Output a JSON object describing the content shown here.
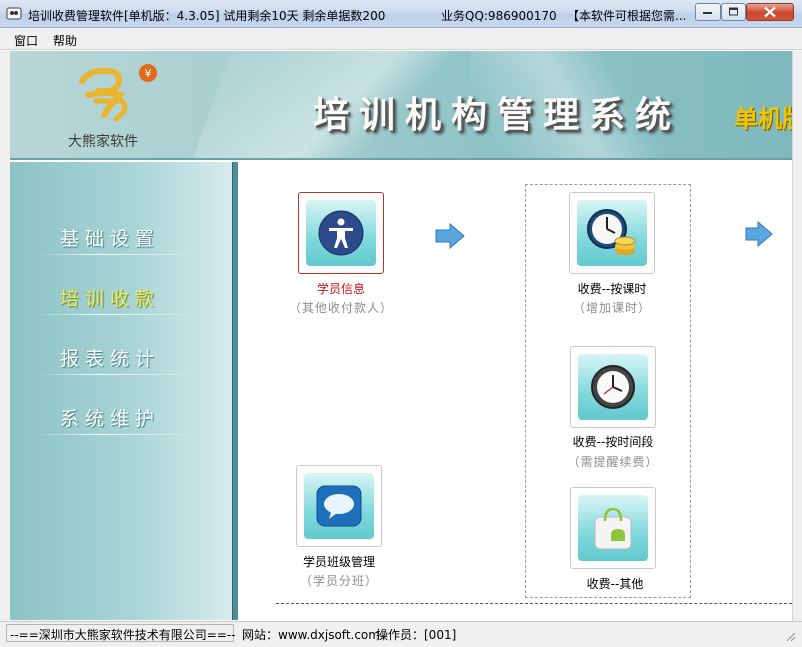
{
  "window": {
    "title": "培训收费管理软件[单机版：4.3.05]  试用剩余10天  剩余单据数200",
    "qq": "业务QQ:986900170",
    "note": "【本软件可根据您需..."
  },
  "menu": {
    "items": [
      "窗口",
      "帮助"
    ]
  },
  "banner": {
    "logo_text": "大熊家软件",
    "title": "培训机构管理系统",
    "edition": "单机版"
  },
  "sidebar": {
    "items": [
      {
        "label": "基础设置",
        "active": false
      },
      {
        "label": "培训收款",
        "active": true
      },
      {
        "label": "报表统计",
        "active": false
      },
      {
        "label": "系统维护",
        "active": false
      }
    ]
  },
  "main": {
    "tiles": [
      {
        "name": "student-info",
        "label": "学员信息",
        "sub": "（其他收付款人）",
        "icon": "person-icon",
        "selected": true
      },
      {
        "name": "fee-by-lesson",
        "label": "收费--按课时",
        "sub": "（增加课时）",
        "icon": "clock-coins-icon",
        "selected": false
      },
      {
        "name": "fee-by-period",
        "label": "收费--按时间段",
        "sub": "（需提醒续费）",
        "icon": "clock-icon",
        "selected": false
      },
      {
        "name": "class-management",
        "label": "学员班级管理",
        "sub": "（学员分班）",
        "icon": "chat-bubble-icon",
        "selected": false
      },
      {
        "name": "fee-other",
        "label": "收费--其他",
        "sub": "",
        "icon": "shopping-bag-icon",
        "selected": false
      }
    ]
  },
  "status": {
    "company": "--==深圳市大熊家软件技术有限公司==--",
    "website": "网站：www.dxjsoft.com",
    "operator": "操作员：[001]"
  },
  "colors": {
    "accent_teal": "#7fd8db",
    "active_nav": "#f2ed5c",
    "selected_border": "#c0302a"
  }
}
